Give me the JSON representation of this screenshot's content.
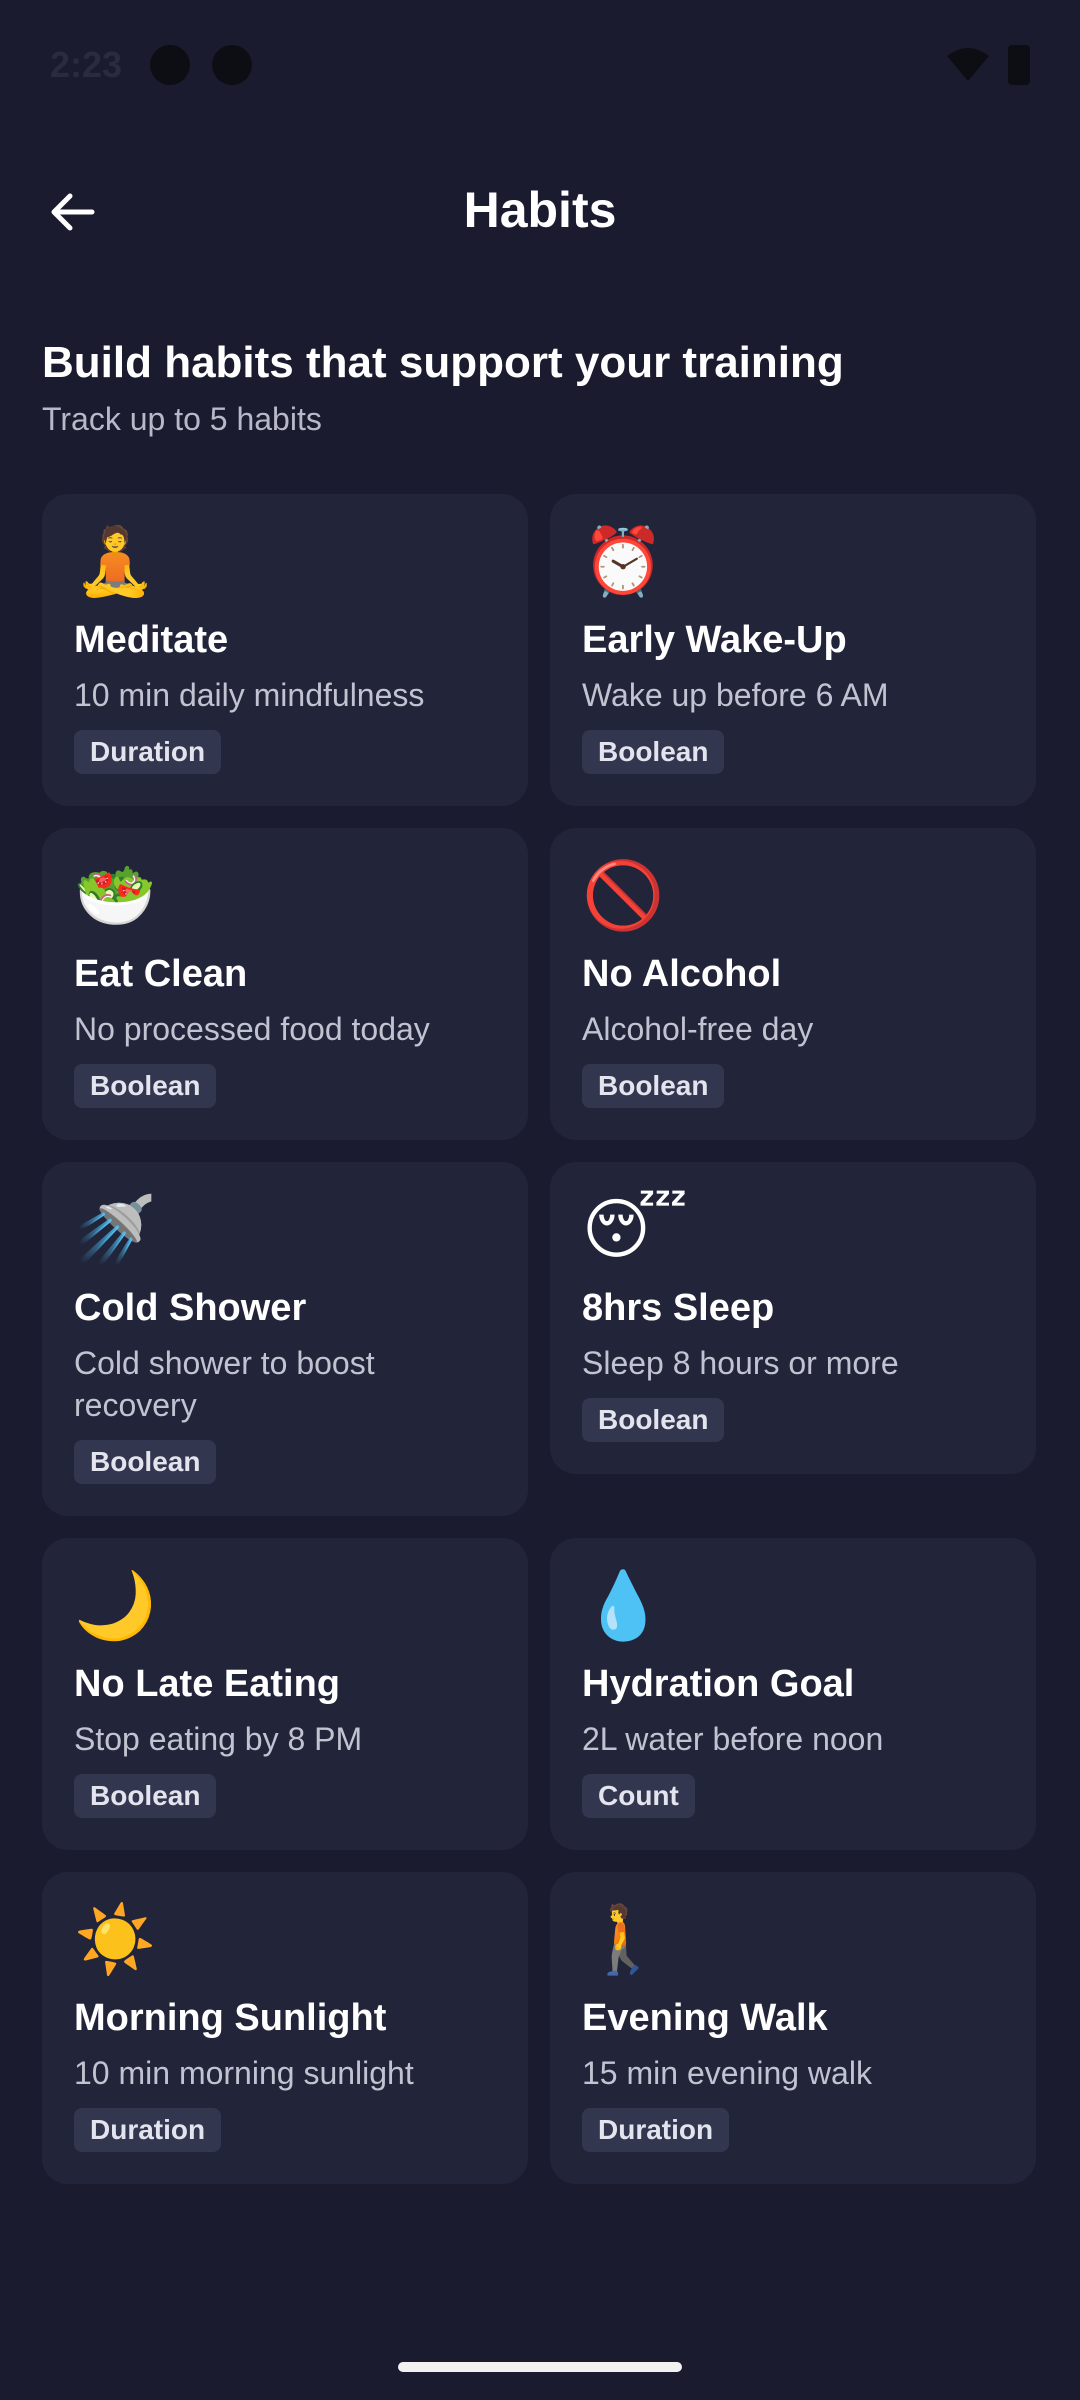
{
  "status": {
    "time": "2:23"
  },
  "header": {
    "title": "Habits"
  },
  "intro": {
    "title": "Build habits that support your training",
    "subtitle": "Track up to 5 habits"
  },
  "habits": [
    {
      "emoji": "🧘",
      "icon": "meditate-icon",
      "title": "Meditate",
      "desc": "10 min daily mindfulness",
      "type": "Duration"
    },
    {
      "emoji": "⏰",
      "icon": "alarm-clock-icon",
      "title": "Early Wake-Up",
      "desc": "Wake up before 6 AM",
      "type": "Boolean"
    },
    {
      "emoji": "🥗",
      "icon": "salad-icon",
      "title": "Eat Clean",
      "desc": "No processed food today",
      "type": "Boolean"
    },
    {
      "emoji": "🚫",
      "icon": "prohibited-icon",
      "title": "No Alcohol",
      "desc": "Alcohol-free day",
      "type": "Boolean"
    },
    {
      "emoji": "🚿",
      "icon": "shower-icon",
      "title": "Cold Shower",
      "desc": "Cold shower to boost recovery",
      "type": "Boolean"
    },
    {
      "emoji": "😴",
      "icon": "sleeping-face-icon",
      "title": "8hrs Sleep",
      "desc": "Sleep 8 hours or more",
      "type": "Boolean"
    },
    {
      "emoji": "🌙",
      "icon": "crescent-moon-icon",
      "title": "No Late Eating",
      "desc": "Stop eating by 8 PM",
      "type": "Boolean"
    },
    {
      "emoji": "💧",
      "icon": "droplet-icon",
      "title": "Hydration Goal",
      "desc": "2L water before noon",
      "type": "Count"
    },
    {
      "emoji": "☀️",
      "icon": "sun-icon",
      "title": "Morning Sunlight",
      "desc": "10 min morning sunlight",
      "type": "Duration"
    },
    {
      "emoji": "🚶",
      "icon": "walking-person-icon",
      "title": "Evening Walk",
      "desc": "15 min evening walk",
      "type": "Duration"
    }
  ]
}
